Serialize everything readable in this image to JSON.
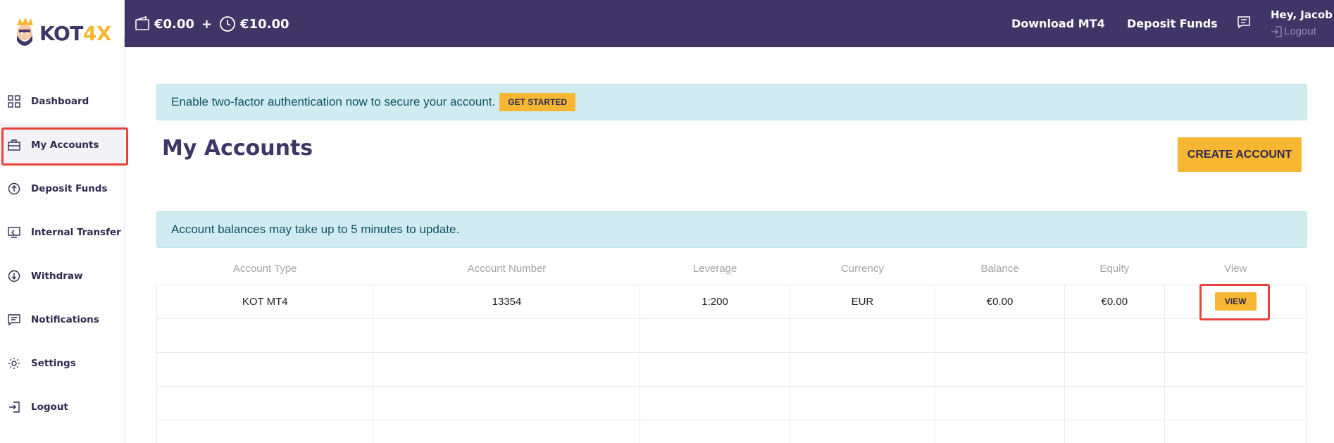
{
  "brand": {
    "word_dark": "KOT",
    "word_accent": "4X"
  },
  "sidebar": {
    "items": [
      {
        "label": "Dashboard",
        "icon": "grid-icon"
      },
      {
        "label": "My Accounts",
        "icon": "briefcase-icon",
        "active": true
      },
      {
        "label": "Deposit Funds",
        "icon": "arrow-up-circle-icon"
      },
      {
        "label": "Internal Transfer",
        "icon": "transfer-icon"
      },
      {
        "label": "Withdraw",
        "icon": "arrow-down-circle-icon"
      },
      {
        "label": "Notifications",
        "icon": "message-icon"
      },
      {
        "label": "Settings",
        "icon": "gear-icon"
      },
      {
        "label": "Logout",
        "icon": "logout-icon"
      }
    ]
  },
  "topbar": {
    "balance": "€0.00",
    "plus": "+",
    "bonus": "€10.00",
    "download_label": "Download MT4",
    "deposit_label": "Deposit Funds",
    "greeting": "Hey, Jacob",
    "logout_label": "Logout"
  },
  "alerts": {
    "twofa_text": "Enable two-factor authentication now to secure your account.",
    "twofa_button": "GET STARTED",
    "balance_note": "Account balances may take up to 5 minutes to update."
  },
  "main": {
    "title": "My Accounts",
    "create_button": "CREATE ACCOUNT"
  },
  "table": {
    "headers": [
      "Account Type",
      "Account Number",
      "Leverage",
      "Currency",
      "Balance",
      "Equity",
      "View"
    ],
    "rows": [
      {
        "type": "KOT MT4",
        "number": "13354",
        "leverage": "1:200",
        "currency": "EUR",
        "balance": "€0.00",
        "equity": "€0.00",
        "view": "VIEW"
      }
    ]
  },
  "colors": {
    "brand_dark": "#3f3566",
    "accent": "#f7b733",
    "alert_bg": "#d1ecf1",
    "highlight": "#e8433b"
  }
}
